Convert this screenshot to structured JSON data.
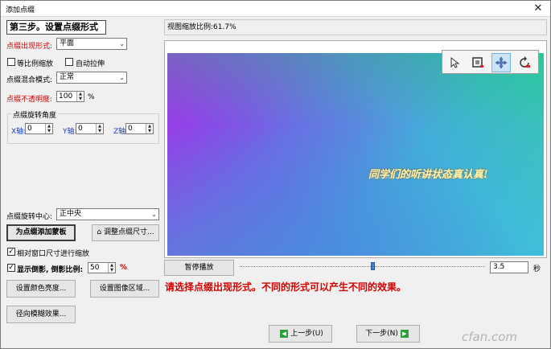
{
  "window": {
    "title": "添加点缀",
    "close_glyph": "✕"
  },
  "left_panel": {
    "step_heading": "第三步。设置点缀形式",
    "appear_form": {
      "label": "点缀出现形式:",
      "value": "平面"
    },
    "keep_ratio": {
      "label": "等比例缩放",
      "checked": false
    },
    "auto_stretch": {
      "label": "自动拉伸",
      "checked": false
    },
    "blend_mode": {
      "label": "点缀混合模式:",
      "value": "正常"
    },
    "opacity": {
      "label": "点缀不透明度:",
      "value": "100",
      "unit": "%"
    },
    "rotation": {
      "title": "点缀旋转角度",
      "x": {
        "label": "X轴:",
        "value": "0"
      },
      "y": {
        "label": "Y轴:",
        "value": "0"
      },
      "z": {
        "label": "Z轴:",
        "value": "0"
      }
    },
    "rotation_center": {
      "label": "点缀旋转中心:",
      "value": "正中央"
    },
    "add_mask_button": "为点缀添加蒙板",
    "adjust_size_button": "调整点缀尺寸...",
    "relative_scale": {
      "label": "相对窗口尺寸进行缩放",
      "checked": true
    },
    "reflection": {
      "label": "显示倒影, 倒影比例:",
      "checked": true,
      "value": "50",
      "unit": "%"
    },
    "set_color_button": "设置颜色亮度...",
    "set_region_button": "设置图像区域...",
    "radial_blur_button": "径向模糊效果..."
  },
  "preview": {
    "zoom_label": "视图缩放比例:61.7%",
    "overlay_text": "同学们的听讲状态真认真!",
    "tools": [
      {
        "name": "pointer-tool-icon",
        "active": false
      },
      {
        "name": "crop-tool-icon",
        "active": false
      },
      {
        "name": "move-tool-icon",
        "active": true
      },
      {
        "name": "rotate-tool-icon",
        "active": false
      }
    ]
  },
  "playback": {
    "pause_button": "暂停播放",
    "progress": 0.54,
    "seconds_value": "3.5",
    "seconds_unit": "秒"
  },
  "hint_text": "请选择点缀出现形式。不同的形式可以产生不同的效果。",
  "navigation": {
    "prev_button": "上一步(U)",
    "next_button": "下一步(N)"
  },
  "watermark": "cfan.com",
  "colors": {
    "accent_red": "#d40000",
    "axis_blue": "#1a3fd0",
    "arrow_green": "#2e9e3e"
  }
}
